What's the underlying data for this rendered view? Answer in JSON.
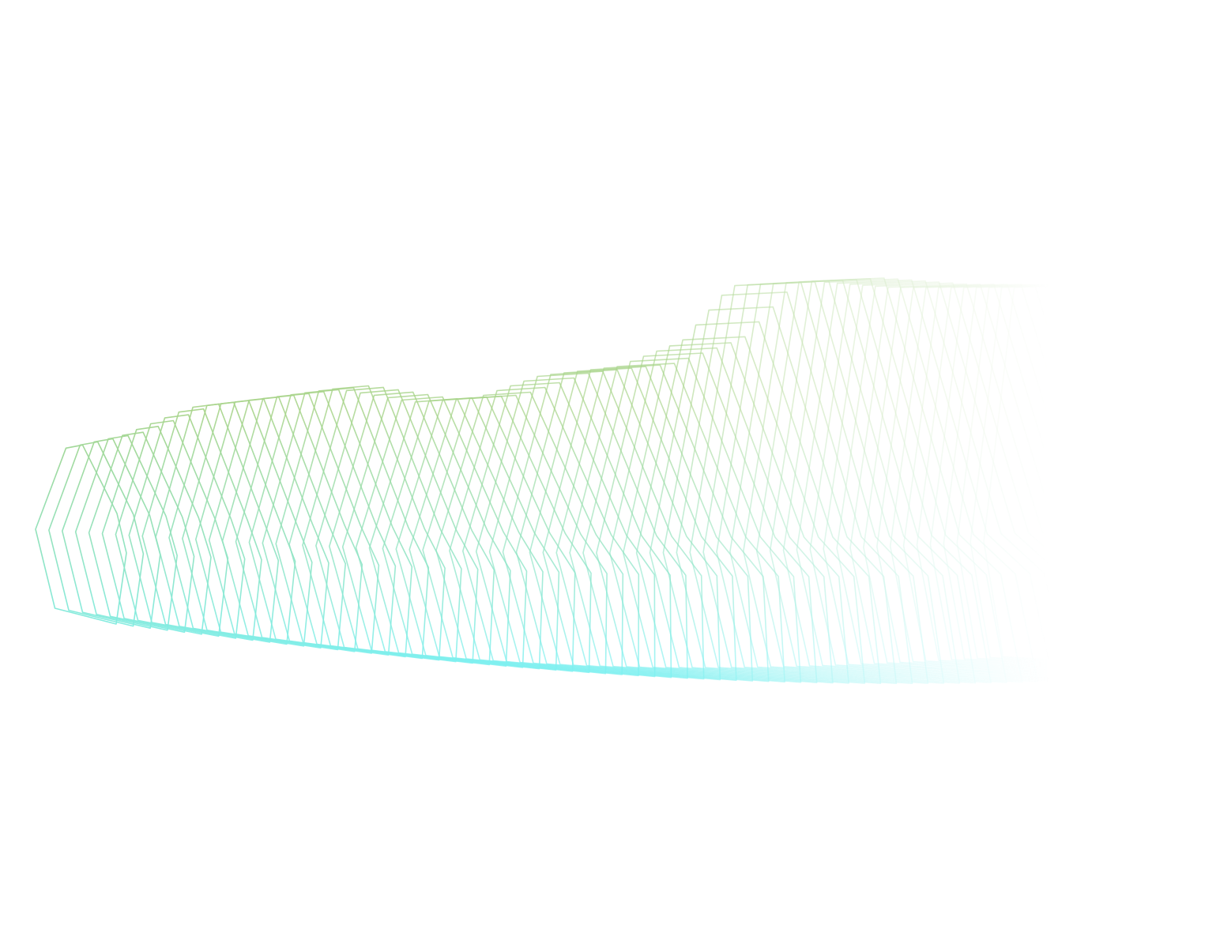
{
  "artwork": {
    "kind": "abstract-line-wave",
    "background": "#ffffff",
    "palette": {
      "green": "#a8d48a",
      "cyan": "#7ef0f0",
      "fade": "#ffffff"
    }
  }
}
